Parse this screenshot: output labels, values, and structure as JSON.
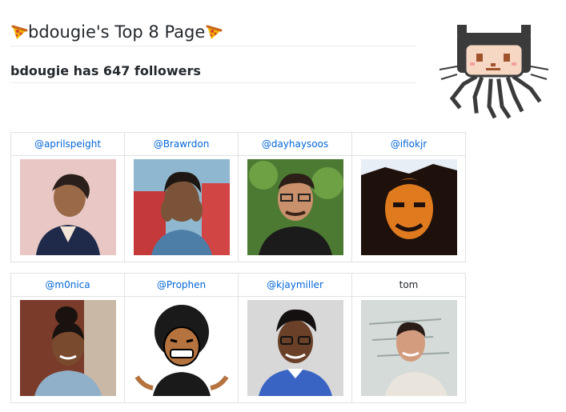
{
  "page": {
    "title": "bdougie's Top 8 Page",
    "subtitle": "bdougie has 647 followers"
  },
  "icons": {
    "title_left": "pizza-icon",
    "title_right": "pizza-icon",
    "mascot": "octocat-icon"
  },
  "colors": {
    "link": "#0366d6",
    "border": "#dfe2e5",
    "text": "#24292e"
  },
  "friends_row1": [
    {
      "handle": "@aprilspeight"
    },
    {
      "handle": "@Brawrdon"
    },
    {
      "handle": "@dayhaysoos"
    },
    {
      "handle": "@ifiokjr"
    }
  ],
  "friends_row2": [
    {
      "handle": "@m0nica"
    },
    {
      "handle": "@Prophen"
    },
    {
      "handle": "@kjaymiller"
    },
    {
      "handle": "tom"
    }
  ]
}
